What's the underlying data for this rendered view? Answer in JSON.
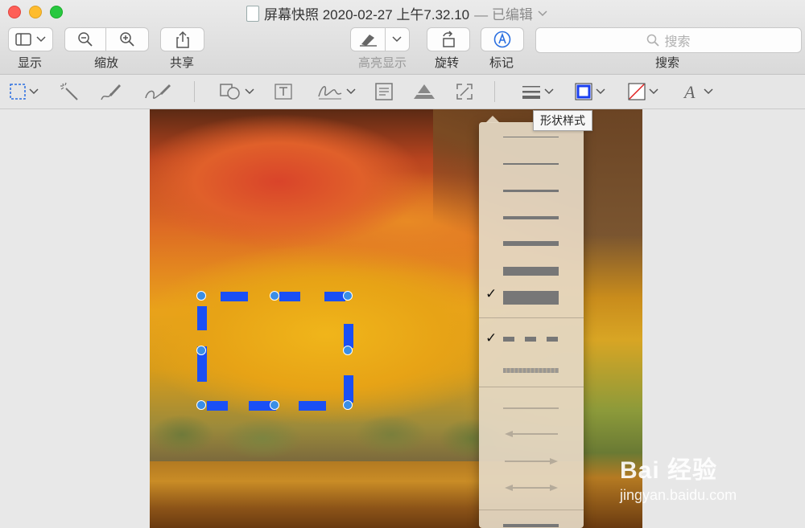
{
  "window": {
    "title": "屏幕快照 2020-02-27 上午7.32.10",
    "title_suffix": "— 已编辑"
  },
  "toolbar": {
    "display_label": "显示",
    "zoom_label": "缩放",
    "share_label": "共享",
    "highlight_label": "高亮显示",
    "rotate_label": "旋转",
    "markup_label": "标记",
    "search_label": "搜索",
    "search_placeholder": "搜索"
  },
  "markup_toolbar": {
    "tools": [
      "selection-tool",
      "instant-alpha",
      "sketch",
      "draw",
      "shapes",
      "text",
      "sign",
      "note",
      "adjust-color",
      "adjust-size",
      "shape-style",
      "border-color",
      "fill-color",
      "text-style"
    ],
    "border_color": "#1a3ff0",
    "fill_color": "none"
  },
  "tooltip": "形状样式",
  "shape_style_menu": {
    "line_weights": [
      1,
      2,
      3,
      4,
      6,
      10,
      16
    ],
    "selected_weight": 16,
    "line_styles": [
      "dashed",
      "rough"
    ],
    "selected_style": "dashed",
    "arrow_options": [
      "plain",
      "left-arrow",
      "right-arrow",
      "both-arrows"
    ]
  },
  "selection": {
    "stroke_color": "#1a4ff5",
    "style": "dashed"
  },
  "watermark": {
    "brand": "Bai 经验",
    "url": "jingyan.baidu.com"
  }
}
